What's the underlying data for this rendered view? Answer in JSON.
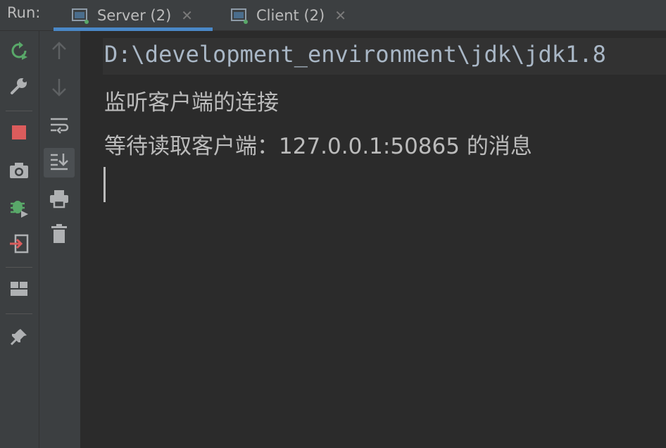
{
  "header": {
    "run_label": "Run:",
    "tabs": [
      {
        "label": "Server (2)",
        "icon": "console-icon",
        "active": true
      },
      {
        "label": "Client (2)",
        "icon": "console-icon",
        "active": false
      }
    ],
    "close_glyph": "✕",
    "active_accent": "#4a88c7"
  },
  "toolbar_left": [
    {
      "name": "rerun-icon",
      "color": "#59a869"
    },
    {
      "name": "wrench-icon",
      "color": "#afb1b3"
    },
    {
      "name": "stop-icon",
      "color": "#db5c5c"
    },
    {
      "name": "camera-icon",
      "color": "#afb1b3"
    },
    {
      "name": "debug-bug-icon",
      "color": "#59a869"
    },
    {
      "name": "exit-icon",
      "color": "#db5c5c"
    },
    {
      "name": "layout-icon",
      "color": "#afb1b3"
    },
    {
      "name": "pin-icon",
      "color": "#afb1b3"
    }
  ],
  "toolbar_right": [
    {
      "name": "arrow-up-icon"
    },
    {
      "name": "arrow-down-icon"
    },
    {
      "name": "soft-wrap-icon"
    },
    {
      "name": "scroll-to-end-icon",
      "active": true
    },
    {
      "name": "print-icon"
    },
    {
      "name": "trash-icon"
    }
  ],
  "console": {
    "command_line": "D:\\development_environment\\jdk\\jdk1.8",
    "lines": [
      "监听客户端的连接",
      "等待读取客户端：127.0.0.1:50865 的消息"
    ]
  }
}
